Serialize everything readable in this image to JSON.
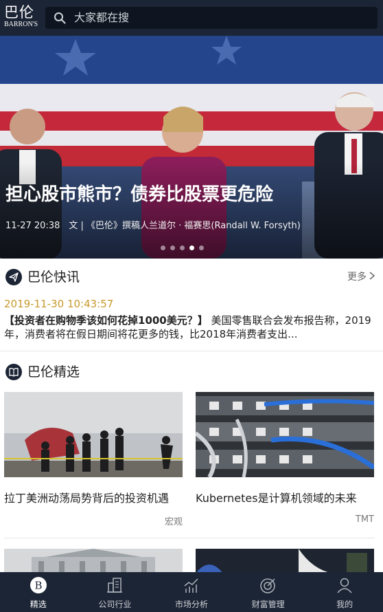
{
  "header": {
    "logo_cn": "巴伦",
    "logo_en": "BARRON'S",
    "search_placeholder": "大家都在搜"
  },
  "hero": {
    "title": "担心股市熊市？债券比股票更危险",
    "meta": "11-27 20:38　文 | 《巴伦》撰稿人兰道尔 · 福赛思(Randall W. Forsyth)",
    "dots": 5,
    "active_dot": 3
  },
  "flash": {
    "section_label": "巴伦快讯",
    "more_label": "更多",
    "time": "2019-11-30 10:43:57",
    "headline": "【投资者在购物季该如何花掉1000美元？】",
    "body": " 美国零售联合会发布报告称，2019年，消费者将在假日期间将花更多的钱，比2018年消费者支出..."
  },
  "picks": {
    "section_label": "巴伦精选",
    "cards": [
      {
        "title": "拉丁美洲动荡局势背后的投资机遇",
        "tag": "宏观"
      },
      {
        "title": "Kubernetes是计算机领域的未来",
        "tag": "TMT"
      }
    ]
  },
  "nav": {
    "items": [
      {
        "label": "精选",
        "icon": "barrons-b-icon",
        "active": true
      },
      {
        "label": "公司行业",
        "icon": "buildings-icon",
        "active": false
      },
      {
        "label": "市场分析",
        "icon": "chart-icon",
        "active": false
      },
      {
        "label": "财富管理",
        "icon": "target-icon",
        "active": false
      },
      {
        "label": "我的",
        "icon": "user-icon",
        "active": false
      }
    ]
  },
  "colors": {
    "header_bg": "#1c2535",
    "timestamp": "#c79a2a",
    "nav_bg": "#1c2535"
  }
}
